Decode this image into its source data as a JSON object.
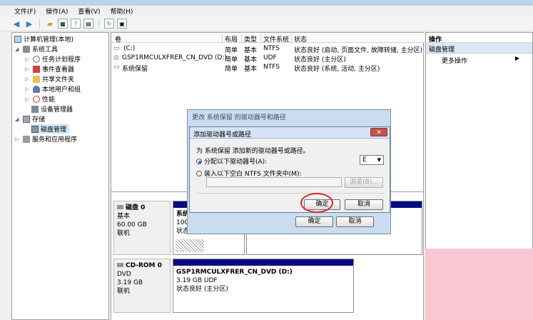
{
  "menu": [
    "文件(F)",
    "操作(A)",
    "查看(V)",
    "帮助(H)"
  ],
  "tree": {
    "root": "计算机管理(本地)",
    "system_tools": "系统工具",
    "task_scheduler": "任务计划程序",
    "event_viewer": "事件查看器",
    "shared_folders": "共享文件夹",
    "local_users": "本地用户和组",
    "performance": "性能",
    "device_manager": "设备管理器",
    "storage": "存储",
    "disk_mgmt": "磁盘管理",
    "services": "服务和应用程序"
  },
  "list": {
    "headers": [
      "卷",
      "布局",
      "类型",
      "文件系统",
      "状态"
    ],
    "rows": [
      {
        "vol": "(C:)",
        "layout": "简单",
        "type": "基本",
        "fs": "NTFS",
        "status": "状态良好 (启动, 页面文件, 故障转储, 主分区)"
      },
      {
        "vol": "GSP1RMCULXFRER_CN_DVD (D:)",
        "layout": "简单",
        "type": "基本",
        "fs": "UDF",
        "status": "状态良好 (主分区)"
      },
      {
        "vol": "系统保留",
        "layout": "简单",
        "type": "基本",
        "fs": "NTFS",
        "status": "状态良好 (系统, 活动, 主分区)"
      }
    ]
  },
  "disks": {
    "disk0": {
      "name": "磁盘 0",
      "type": "基本",
      "size": "60.00 GB",
      "state": "联机",
      "part_name": "系统",
      "part_size": "100",
      "part_status": "状态"
    },
    "cdrom0": {
      "name": "CD-ROM 0",
      "type": "DVD",
      "size": "3.19 GB",
      "state": "联机",
      "part_name": "GSP1RMCULXFRER_CN_DVD  (D:)",
      "part_size": "3.19 GB UDF",
      "part_status": "状态良好 (主分区)"
    }
  },
  "actions": {
    "header": "操作",
    "section": "磁盘管理",
    "more": "更多操作"
  },
  "outer_dialog": {
    "title": "更改 系统保留 的驱动器号和路径",
    "ok": "确定",
    "cancel": "取消"
  },
  "inner_dialog": {
    "title": "添加驱动器号或路径",
    "desc": "为 系统保留 添加新的驱动器号或路径。",
    "opt1": "分配以下驱动器号(A):",
    "drive_letter": "E",
    "opt2": "装入以下空白 NTFS 文件夹中(M):",
    "browse": "浏览(B)...",
    "ok": "确定",
    "cancel": "取消"
  },
  "colors": {
    "highlight": "#cde8ff",
    "partition_bar": "#0a0a80",
    "annotation": "#d9262a"
  }
}
